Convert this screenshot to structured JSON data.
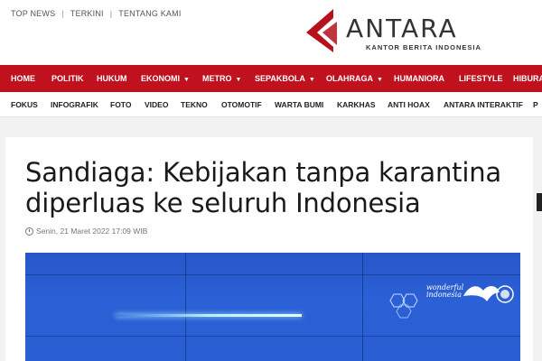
{
  "top_links": [
    "TOP NEWS",
    "TERKINI",
    "TENTANG KAMI"
  ],
  "logo": {
    "brand": "ANTARA",
    "tagline": "KANTOR BERITA INDONESIA"
  },
  "main_nav": [
    {
      "label": "HOME",
      "dropdown": false
    },
    {
      "label": "POLITIK",
      "dropdown": false
    },
    {
      "label": "HUKUM",
      "dropdown": false
    },
    {
      "label": "EKONOMI",
      "dropdown": true
    },
    {
      "label": "METRO",
      "dropdown": true
    },
    {
      "label": "SEPAKBOLA",
      "dropdown": true
    },
    {
      "label": "OLAHRAGA",
      "dropdown": true
    },
    {
      "label": "HUMANIORA",
      "dropdown": false
    },
    {
      "label": "LIFESTYLE",
      "dropdown": false
    },
    {
      "label": "HIBURA",
      "dropdown": false
    }
  ],
  "sub_nav": [
    "FOKUS",
    "INFOGRAFIK",
    "FOTO",
    "VIDEO",
    "TEKNO",
    "OTOMOTIF",
    "WARTA BUMI",
    "KARKHAS",
    "ANTI HOAX",
    "ANTARA INTERAKTIF",
    "P"
  ],
  "article": {
    "headline": "Sandiaga: Kebijakan tanpa karantina diperluas ke seluruh Indonesia",
    "date": "Senin, 21 Maret 2022 17:09 WIB",
    "photo_caption_logo_line1": "wonderful",
    "photo_caption_logo_line2": "indonesia"
  },
  "colors": {
    "brand_red": "#c0111f",
    "photo_blue": "#2a5ed2"
  }
}
